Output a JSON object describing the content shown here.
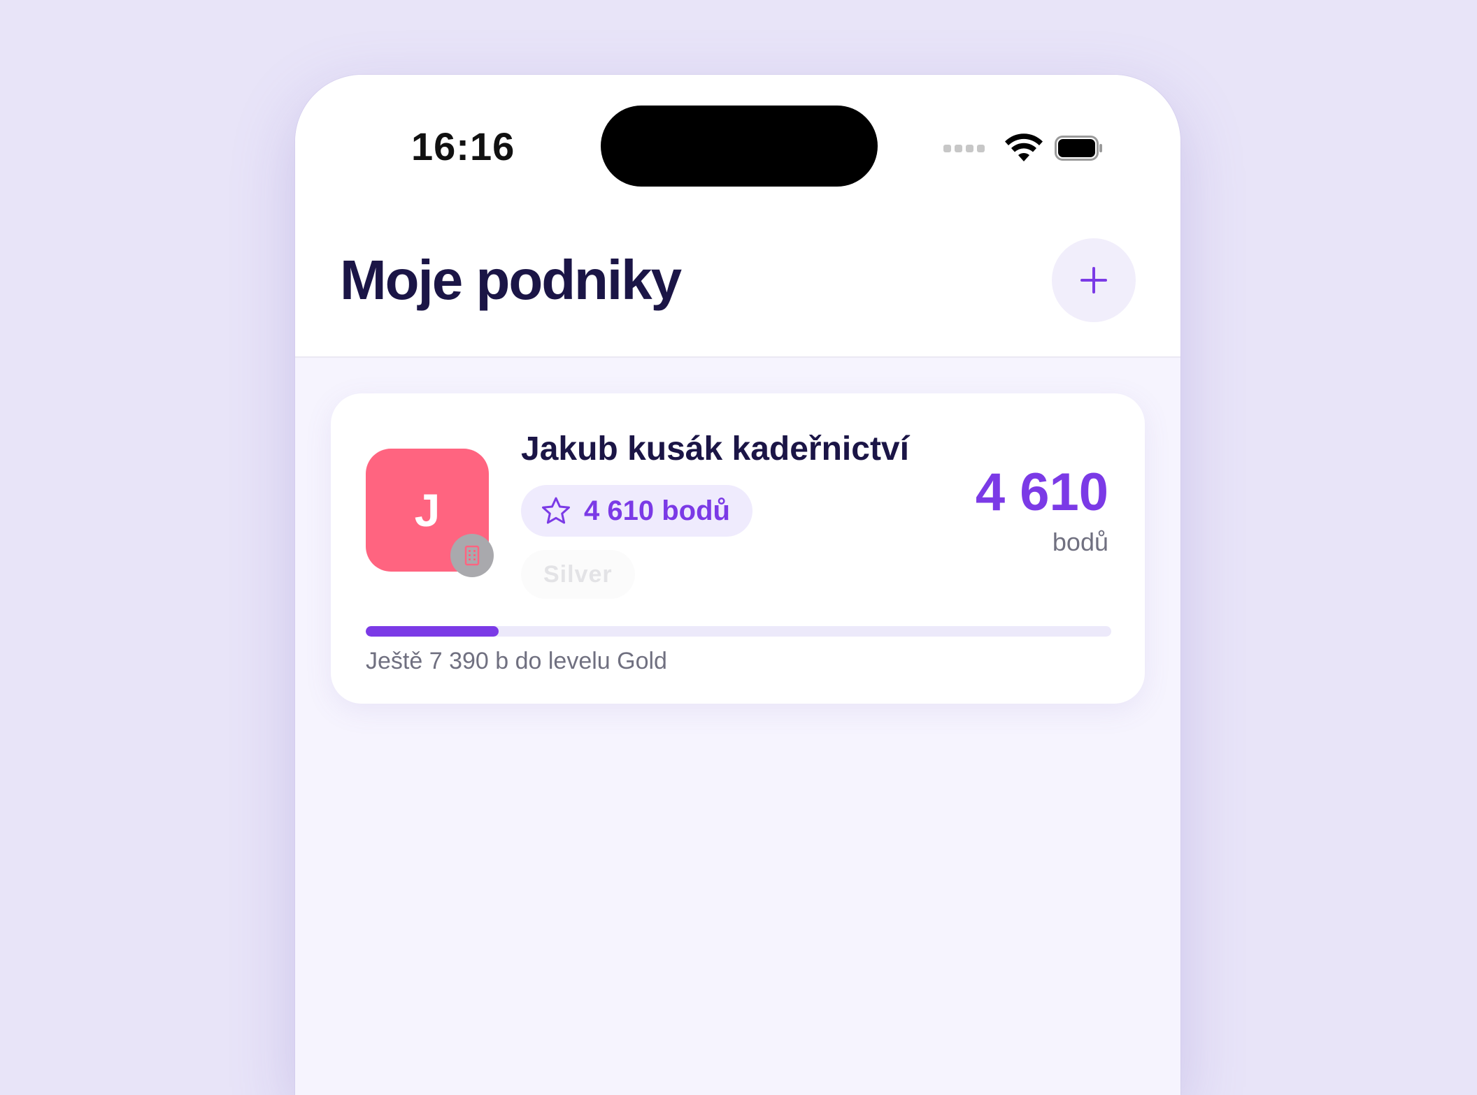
{
  "status_bar": {
    "time": "16:16",
    "icons": [
      "cellular-signal-icon",
      "wifi-icon",
      "battery-icon"
    ]
  },
  "header": {
    "title": "Moje podniky",
    "add_button_icon": "plus-icon"
  },
  "business_card": {
    "avatar_letter": "J",
    "avatar_color": "#ff6480",
    "avatar_badge_icon": "building-icon",
    "name": "Jakub kusák kadeřnictví",
    "points_pill_icon": "star-icon",
    "points_pill": "4 610 bodů",
    "level": "Silver",
    "points_value": "4 610",
    "points_unit": "bodů",
    "progress": {
      "fraction": 0.178,
      "caption": "Ještě 7 390 b do levelu Gold"
    }
  },
  "colors": {
    "accent": "#7b3ae6",
    "title": "#1b1546",
    "background": "#e8e4f8"
  }
}
